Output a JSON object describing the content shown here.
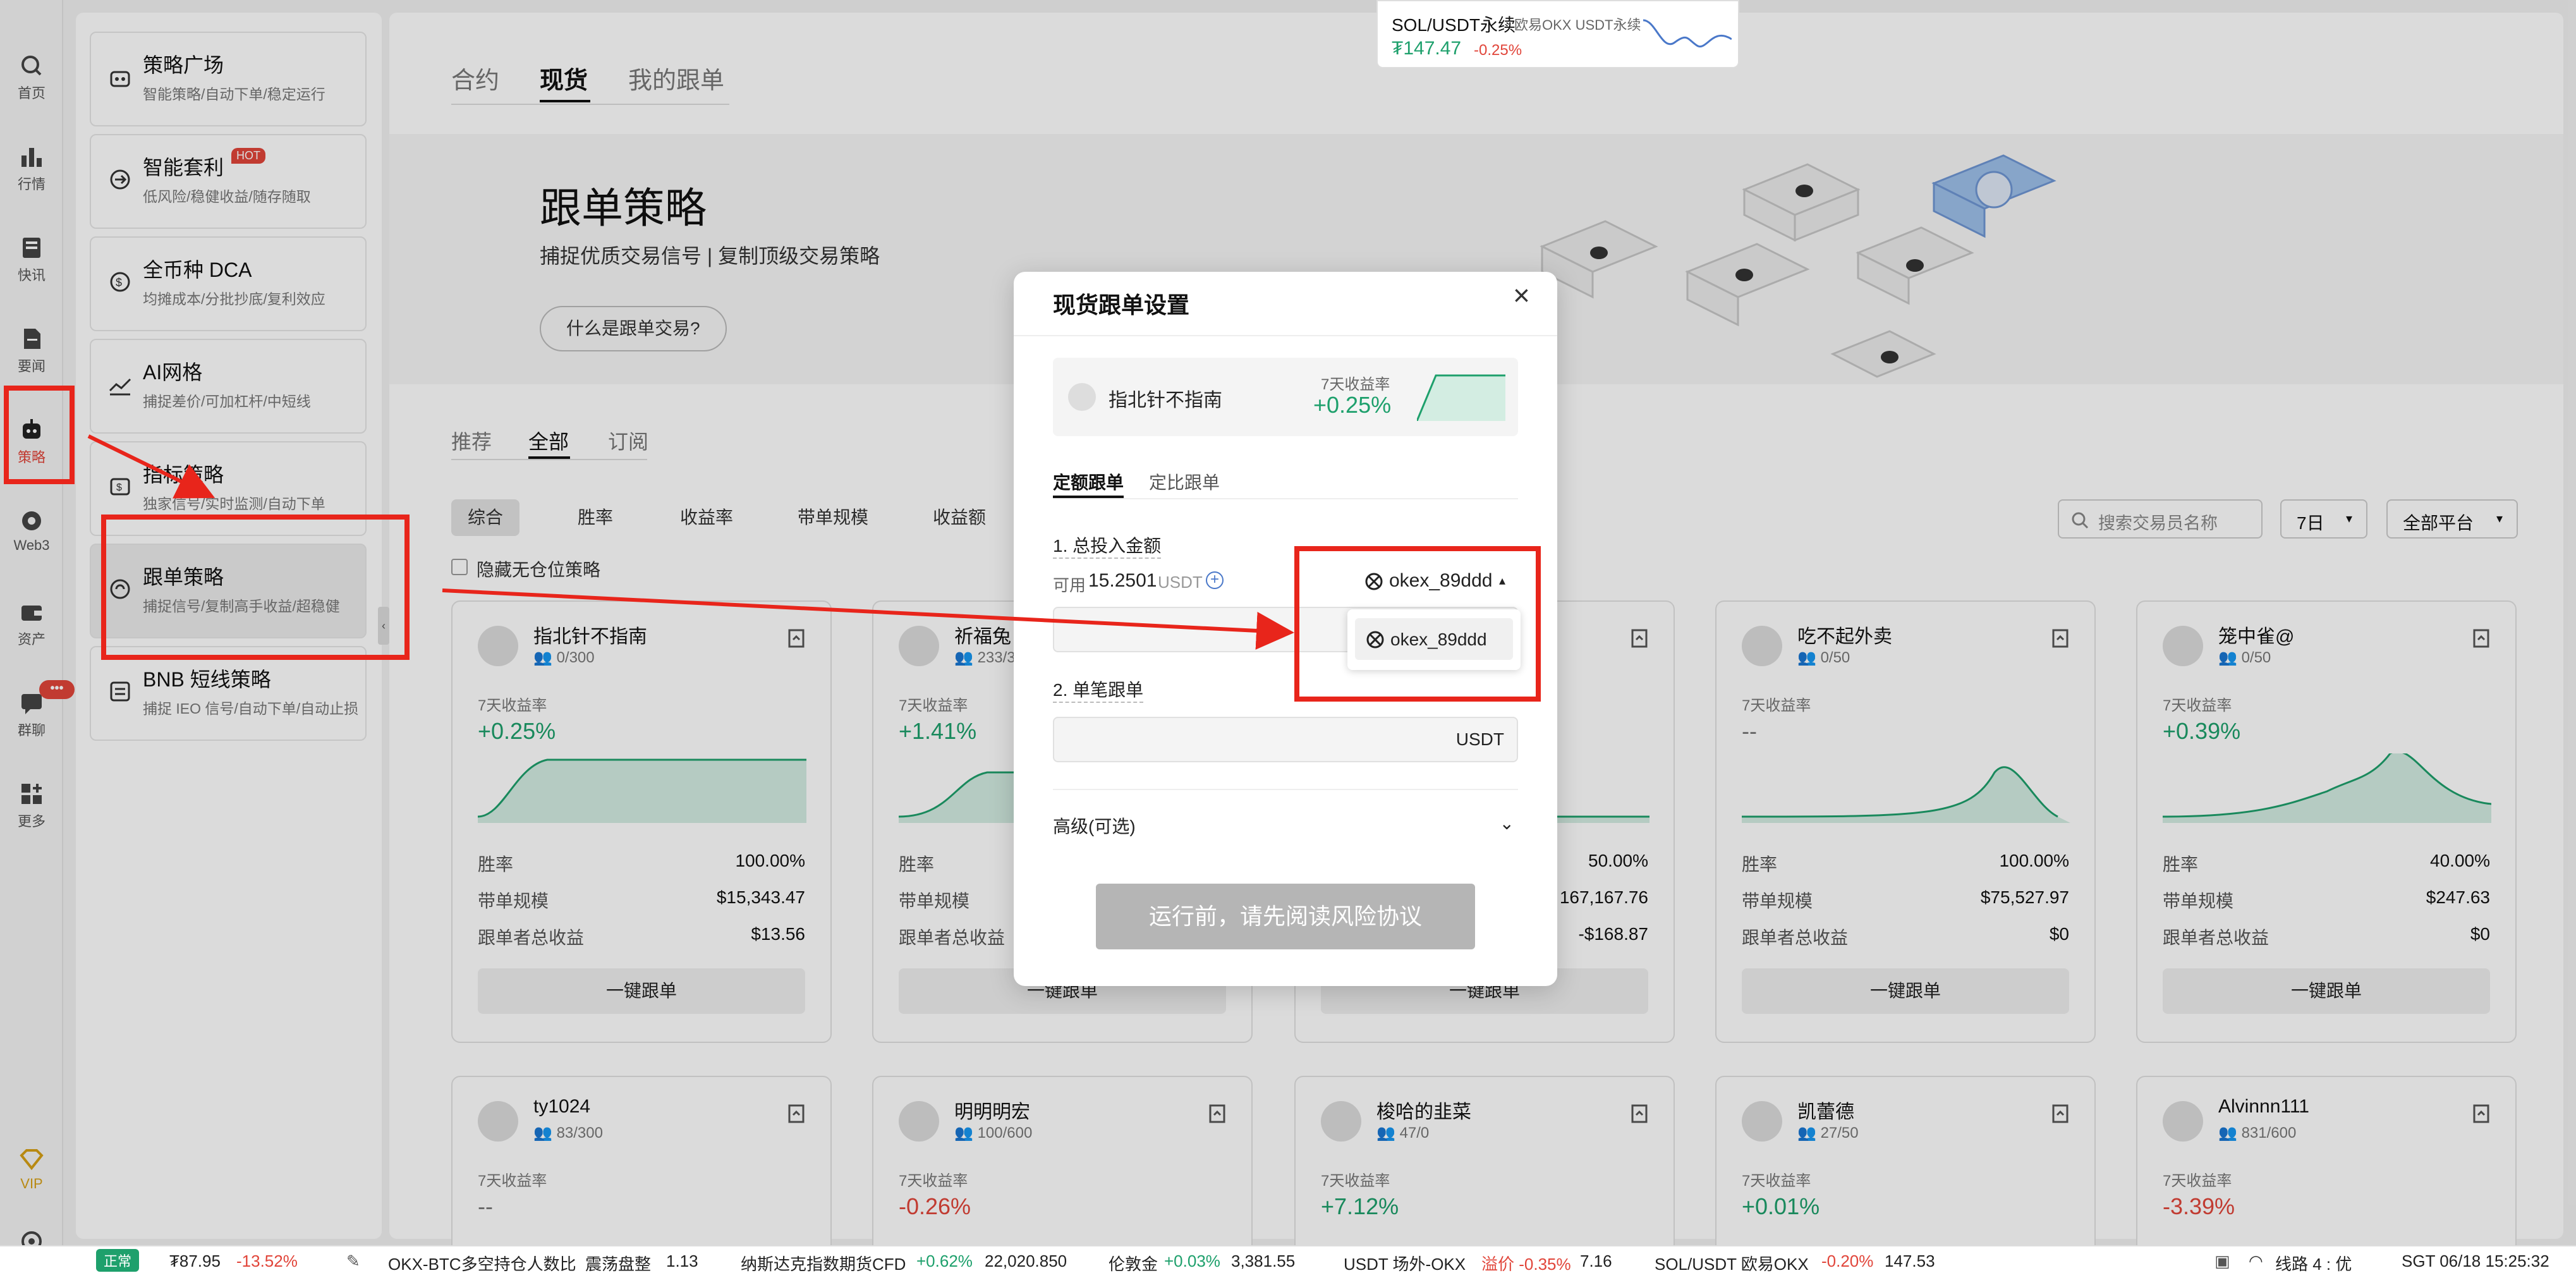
{
  "rail": {
    "items": [
      {
        "label": "首页",
        "icon": "home-icon"
      },
      {
        "label": "行情",
        "icon": "market-icon"
      },
      {
        "label": "快讯",
        "icon": "flash-news-icon"
      },
      {
        "label": "要闻",
        "icon": "news-icon"
      },
      {
        "label": "策略",
        "icon": "robot-icon"
      },
      {
        "label": "Web3",
        "icon": "web3-icon"
      },
      {
        "label": "资产",
        "icon": "wallet-icon"
      },
      {
        "label": "群聊",
        "icon": "chat-icon"
      },
      {
        "label": "更多",
        "icon": "more-icon"
      }
    ],
    "chat_badge": "•••",
    "vip_label": "VIP"
  },
  "strategy_menu": [
    {
      "title": "策略广场",
      "desc": "智能策略/自动下单/稳定运行",
      "icon": "bot-icon"
    },
    {
      "title": "智能套利",
      "desc": "低风险/稳健收益/随存随取",
      "icon": "arbitrage-icon",
      "badge": "HOT"
    },
    {
      "title": "全币种 DCA",
      "desc": "均摊成本/分批抄底/复利效应",
      "icon": "dca-icon"
    },
    {
      "title": "AI网格",
      "desc": "捕捉差价/可加杠杆/中短线",
      "icon": "grid-icon"
    },
    {
      "title": "指标策略",
      "desc": "独家信号/实时监测/自动下单",
      "icon": "indicator-icon"
    },
    {
      "title": "跟单策略",
      "desc": "捕捉信号/复制高手收益/超稳健",
      "icon": "copy-trade-icon"
    },
    {
      "title": "BNB 短线策略",
      "desc": "捕捉 IEO 信号/自动下单/自动止损",
      "icon": "bnb-icon"
    }
  ],
  "main": {
    "tabs": [
      "合约",
      "现货",
      "我的跟单"
    ],
    "hero_title": "跟单策略",
    "hero_sub": "捕捉优质交易信号 | 复制顶级交易策略",
    "hero_btn": "什么是跟单交易?",
    "subtabs": [
      "推荐",
      "全部",
      "订阅"
    ],
    "filters": [
      "综合",
      "胜率",
      "收益率",
      "带单规模",
      "收益额"
    ],
    "hide_label": "隐藏无仓位策略",
    "search_placeholder": "搜索交易员名称",
    "period": "7日",
    "platform": "全部平台"
  },
  "labels": {
    "return7": "7天收益率",
    "winrate": "胜率",
    "scale": "带单规模",
    "follower_profit": "跟单者总收益",
    "follow_btn": "一键跟单"
  },
  "cards_row1": [
    {
      "name": "指北针不指南",
      "followers": "0/300",
      "ret": "+0.25%",
      "win": "100.00%",
      "scale": "$15,343.47",
      "profit": "$13.56"
    },
    {
      "name": "祈福兔",
      "followers": "233/3",
      "ret": "+1.41%",
      "win": "",
      "scale": "",
      "profit": ""
    },
    {
      "name": "",
      "followers": "",
      "ret": "",
      "win": "50.00%",
      "scale": "167,167.76",
      "profit": "-$168.87"
    },
    {
      "name": "吃不起外卖",
      "followers": "0/50",
      "ret": "--",
      "win": "100.00%",
      "scale": "$75,527.97",
      "profit": "$0"
    },
    {
      "name": "笼中雀@",
      "followers": "0/50",
      "ret": "+0.39%",
      "win": "40.00%",
      "scale": "$247.63",
      "profit": "$0"
    }
  ],
  "cards_row2": [
    {
      "name": "ty1024",
      "followers": "83/300",
      "ret": "--"
    },
    {
      "name": "明明明宏",
      "followers": "100/600",
      "ret": "-0.26%"
    },
    {
      "name": "梭哈的韭菜",
      "followers": "47/0",
      "ret": "+7.12%"
    },
    {
      "name": "凯蕾德",
      "followers": "27/50",
      "ret": "+0.01%"
    },
    {
      "name": "Alvinnn111",
      "followers": "831/600",
      "ret": "-3.39%"
    }
  ],
  "ticker_card": {
    "pair": "SOL/USDT永续",
    "source": "欧易OKX USDT永续",
    "price": "₮147.47",
    "change": "-0.25%"
  },
  "modal": {
    "title": "现货跟单设置",
    "trader_name": "指北针不指南",
    "ret_label": "7天收益率",
    "ret_value": "+0.25%",
    "tabs": [
      "定额跟单",
      "定比跟单"
    ],
    "amount_label": "1. 总投入金额",
    "available_label": "可用",
    "available_value": "15.2501",
    "available_unit": "USDT",
    "account_selected": "okex_89ddd",
    "account_option": "okex_89ddd",
    "single_label": "2. 单笔跟单",
    "single_unit": "USDT",
    "advanced": "高级(可选)",
    "submit": "运行前，请先阅读风险协议"
  },
  "bottom": {
    "status": "正常",
    "items": [
      {
        "text": "₮87.95"
      },
      {
        "text": "-13.52%"
      },
      {
        "text": "OKX-BTC多空持仓人数比"
      },
      {
        "text": "震荡盘整"
      },
      {
        "text": "1.13"
      },
      {
        "text": "纳斯达克指数期货CFD"
      },
      {
        "text": "+0.62%"
      },
      {
        "text": "22,020.850"
      },
      {
        "text": "伦敦金"
      },
      {
        "text": "+0.03%"
      },
      {
        "text": "3,381.55"
      },
      {
        "text": "USDT 场外-OKX"
      },
      {
        "text": "溢价 -0.35%"
      },
      {
        "text": "7.16"
      },
      {
        "text": "SOL/USDT 欧易OKX"
      },
      {
        "text": "-0.20%"
      },
      {
        "text": "147.53"
      },
      {
        "text": "线路 4 : 优"
      },
      {
        "text": "SGT 06/18 15:25:32"
      }
    ]
  },
  "colors": {
    "accent": "#1ea06c",
    "negative": "#e1453a",
    "annotation": "#e8251b"
  }
}
